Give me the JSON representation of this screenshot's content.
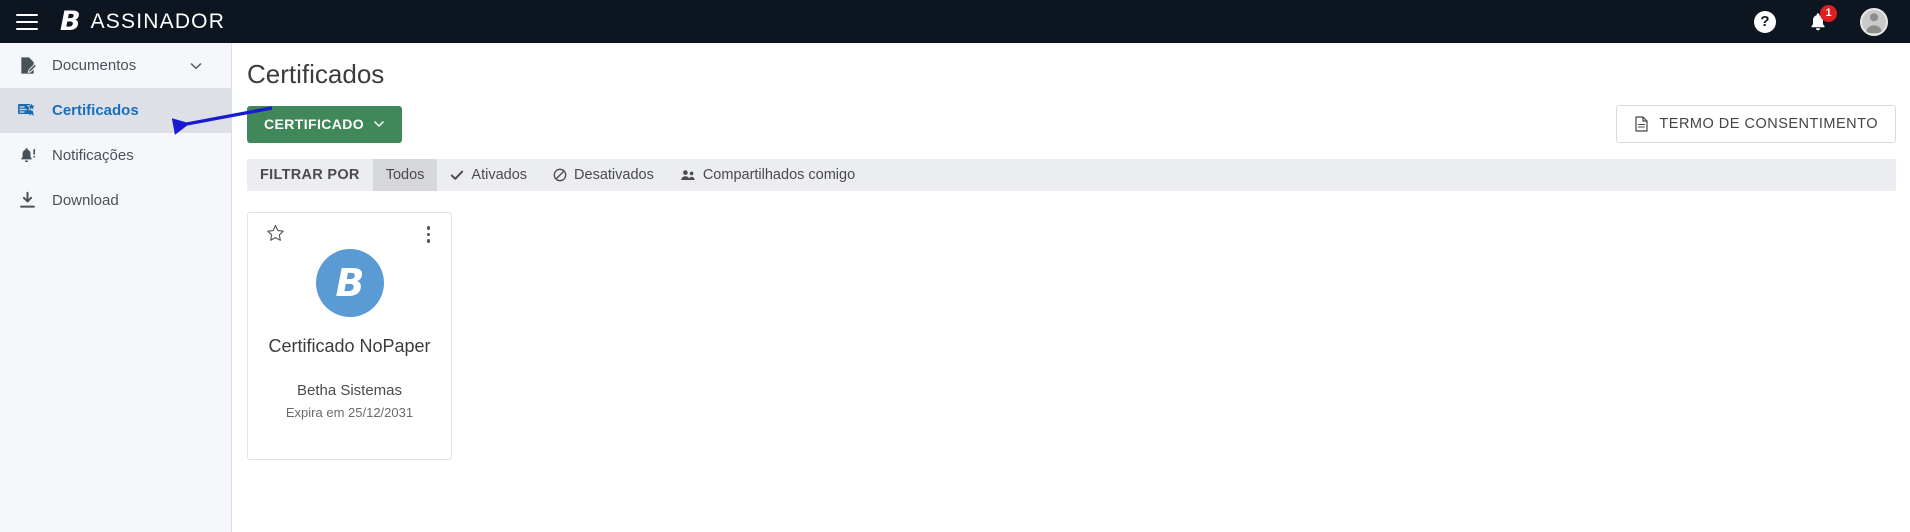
{
  "topbar": {
    "menu_icon": "hamburger-icon",
    "logo_letter": "B",
    "brand": "ASSINADOR",
    "help_icon": "?",
    "notification_icon": "bell-icon",
    "notification_count": "1",
    "avatar_icon": "user-avatar-icon"
  },
  "sidebar": {
    "items": [
      {
        "label": "Documentos",
        "icon": "document-edit-icon",
        "active": false,
        "chevron": true
      },
      {
        "label": "Certificados",
        "icon": "certificate-icon",
        "active": true,
        "chevron": false
      },
      {
        "label": "Notificações",
        "icon": "bell-alert-icon",
        "active": false,
        "chevron": false
      },
      {
        "label": "Download",
        "icon": "download-icon",
        "active": false,
        "chevron": false
      }
    ]
  },
  "main": {
    "page_title": "Certificados",
    "primary_button": {
      "label": "CERTIFICADO",
      "icon": "chevron-down-icon",
      "color": "#40875a"
    },
    "consent_button": {
      "label": "TERMO DE CONSENTIMENTO",
      "icon": "document-icon"
    },
    "filter": {
      "label": "FILTRAR POR",
      "options": [
        {
          "label": "Todos",
          "icon": "none",
          "selected": true
        },
        {
          "label": "Ativados",
          "icon": "check-icon",
          "selected": false
        },
        {
          "label": "Desativados",
          "icon": "ban-icon",
          "selected": false
        },
        {
          "label": "Compartilhados comigo",
          "icon": "people-icon",
          "selected": false
        }
      ]
    },
    "cards": [
      {
        "star_icon": "star-outline-icon",
        "menu_icon": "more-vertical-icon",
        "avatar_letter": "B",
        "avatar_color": "#5b9bd5",
        "title": "Certificado NoPaper",
        "owner": "Betha Sistemas",
        "expiry": "Expira em 25/12/2031"
      }
    ]
  },
  "annotation": {
    "arrow_color": "#1a1ad0",
    "arrow_target": "sidebar-item-certificados"
  }
}
